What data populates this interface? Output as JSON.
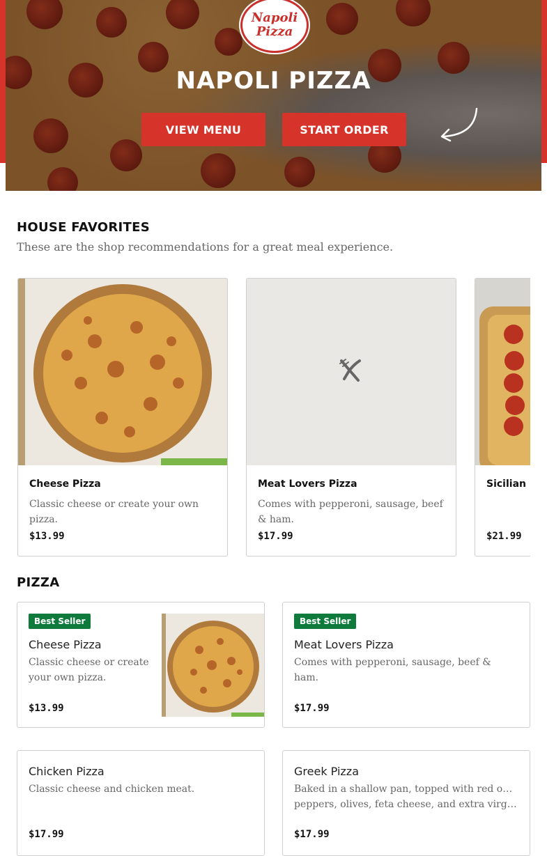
{
  "brand": {
    "logo_line1": "Napoli",
    "logo_line2": "Pizza",
    "title": "NAPOLI PIZZA",
    "view_menu": "VIEW MENU",
    "start_order": "START ORDER",
    "accent_color": "#d6342b"
  },
  "favorites": {
    "title": "HOUSE FAVORITES",
    "subtitle": "These are the shop recommendations for a great meal experience.",
    "items": [
      {
        "name": "Cheese Pizza",
        "desc": "Classic cheese or create your own pizza.",
        "price": "$13.99",
        "image": "cheese-pizza-photo"
      },
      {
        "name": "Meat Lovers Pizza",
        "desc": "Comes with pepperoni, sausage, beef & ham.",
        "price": "$17.99",
        "image": "utensils-placeholder-icon"
      },
      {
        "name": "Sicilian P",
        "desc": "",
        "price": "$21.99",
        "image": "sicilian-pizza-photo"
      }
    ]
  },
  "pizza": {
    "title": "PIZZA",
    "badge_color": "#0e7a3c",
    "items": [
      {
        "badge": "Best Seller",
        "name": "Cheese Pizza",
        "desc": "Classic cheese or create your own pizza.",
        "price": "$13.99"
      },
      {
        "badge": "Best Seller",
        "name": "Meat Lovers Pizza",
        "desc": "Comes with pepperoni, sausage, beef & ham.",
        "price": "$17.99"
      },
      {
        "name": "Chicken Pizza",
        "desc": "Classic cheese and chicken meat.",
        "price": "$17.99"
      },
      {
        "name": "Greek Pizza",
        "desc_line1": "Baked in a shallow pan, topped with red onions,",
        "desc_line2": "peppers, olives, feta cheese, and extra virgin oliv...",
        "price": "$17.99"
      }
    ]
  }
}
